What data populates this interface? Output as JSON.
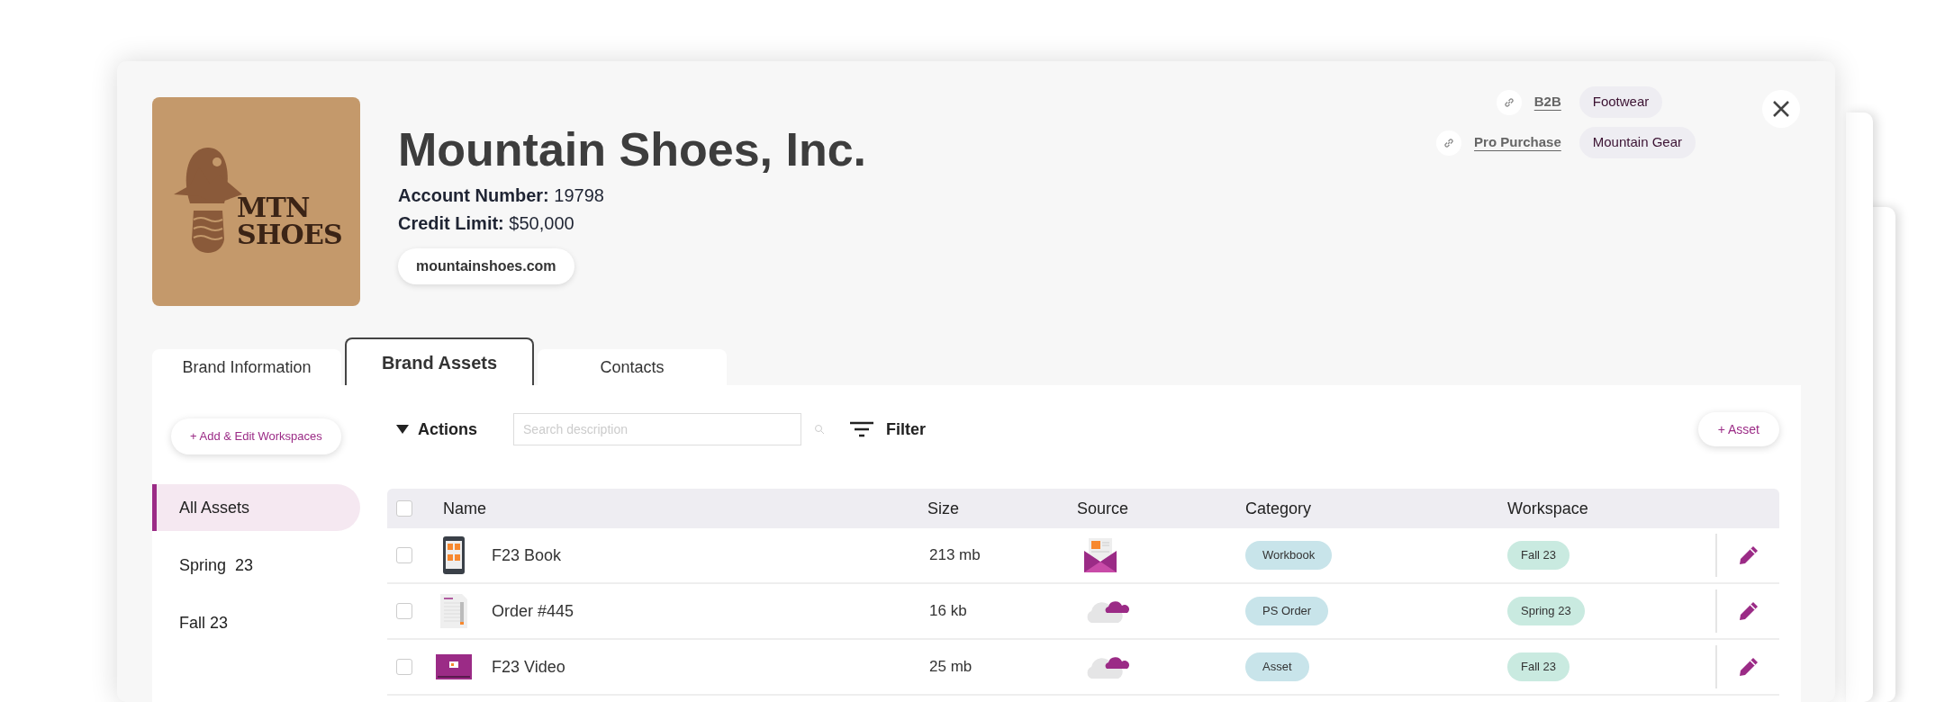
{
  "header": {
    "title": "Mountain Shoes, Inc.",
    "logo_text": [
      "MTN",
      "SHOES"
    ],
    "fields": [
      {
        "label": "Account Number:",
        "value": "19798"
      },
      {
        "label": "Credit Limit:",
        "value": "$50,000"
      }
    ],
    "website": "mountainshoes.com",
    "links": [
      {
        "label": "B2B",
        "tag": "Footwear"
      },
      {
        "label": "Pro Purchase",
        "tag": "Mountain Gear"
      }
    ]
  },
  "tabs": [
    {
      "label": "Brand Information",
      "selected": false
    },
    {
      "label": "Brand Assets",
      "selected": true
    },
    {
      "label": "Contacts",
      "selected": false
    }
  ],
  "sidebar": {
    "button": "+ Add & Edit Workspaces",
    "items": [
      {
        "label": "All Assets",
        "selected": true
      },
      {
        "label": "Spring  23",
        "selected": false
      },
      {
        "label": "Fall 23",
        "selected": false
      }
    ]
  },
  "toolbar": {
    "actions": "Actions",
    "search": {
      "placeholder": "Search description"
    },
    "filter": "Filter",
    "add_button": "+ Asset"
  },
  "table": {
    "select_all_checked": false,
    "columns": [
      "Name",
      "Size",
      "Source",
      "Category",
      "Workspace"
    ],
    "rows": [
      {
        "checked": false,
        "kind": "tablet",
        "name": "F23 Book",
        "size": "213 mb",
        "source": {
          "kind": "email"
        },
        "category": "Workbook",
        "workspace": "Fall 23"
      },
      {
        "checked": false,
        "kind": "document",
        "name": "Order #445",
        "size": "16 kb",
        "source": {
          "kind": "cloud"
        },
        "category": "PS Order",
        "workspace": "Spring 23"
      },
      {
        "checked": false,
        "kind": "video",
        "name": "F23 Video",
        "size": "25 mb",
        "source": {
          "kind": "cloud"
        },
        "category": "Asset",
        "workspace": "Fall 23"
      }
    ]
  }
}
